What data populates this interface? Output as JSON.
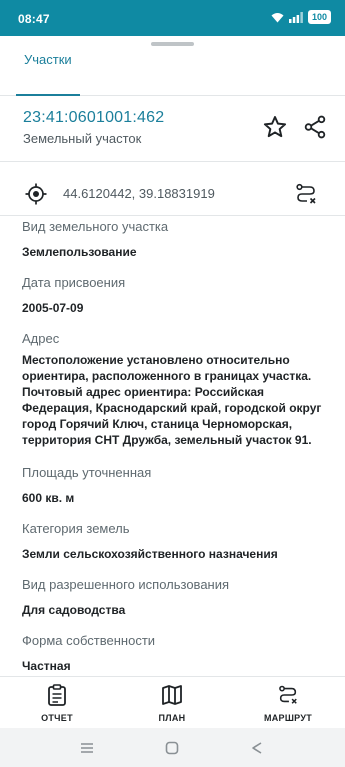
{
  "status_bar": {
    "time": "08:47",
    "icons": [
      "wifi-icon",
      "signal-icon",
      "battery-icon"
    ],
    "battery_level": "100"
  },
  "tabs": [
    {
      "label": "Участки",
      "active": true
    }
  ],
  "parcel": {
    "cadastral_number": "23:41:0601001:462",
    "type": "Земельный участок",
    "coordinates": "44.6120442, 39.18831919"
  },
  "details": {
    "land_kind": {
      "label": "Вид земельного участка",
      "value": "Землепользование"
    },
    "assigned_date": {
      "label": "Дата присвоения",
      "value": "2005-07-09"
    },
    "address": {
      "label": "Адрес",
      "lines": [
        "Местоположение установлено относительно",
        "ориентира, расположенного в границах участка.",
        "Почтовый адрес ориентира: Российская",
        "Федерация, Краснодарский край, городской округ",
        "город Горячий Ключ, станица Черноморская,",
        "территория СНТ Дружба, земельный участок 91."
      ]
    },
    "area": {
      "label": "Площадь уточненная",
      "value": "600 кв. м"
    },
    "land_category": {
      "label": "Категория земель",
      "value": "Земли сельскохозяйственного назначения"
    },
    "permitted_use": {
      "label": "Вид разрешенного использования",
      "value": "Для садоводства"
    },
    "ownership": {
      "label": "Форма собственности",
      "value": "Частная"
    }
  },
  "bottom_nav": {
    "report": "ОТЧЕТ",
    "plan": "ПЛАН",
    "route": "МАРШРУТ"
  },
  "colors": {
    "accent": "#1b7f9b",
    "status_bar": "#0f8aa3"
  }
}
